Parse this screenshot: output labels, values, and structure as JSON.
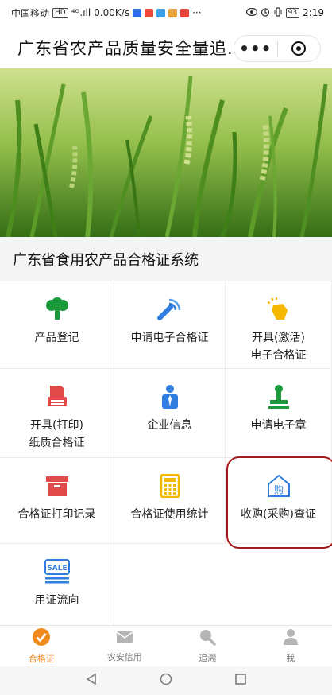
{
  "status_bar": {
    "carrier": "中国移动",
    "net_type": "HD",
    "signal": "⁴ᴳ.ıll",
    "speed": "0.00K/s",
    "extra": "···",
    "battery": "93",
    "time": "2:19"
  },
  "header": {
    "title": "广东省农产品质量安全量追...",
    "more_label": "•••"
  },
  "section": {
    "title": "广东省食用农产品合格证系统"
  },
  "grid": {
    "items": [
      {
        "label": "产品登记",
        "label2": "",
        "icon": "broccoli-icon",
        "color": "#1a9a3a"
      },
      {
        "label": "申请电子合格证",
        "label2": "",
        "icon": "satellite-dish-icon",
        "color": "#2f7de0"
      },
      {
        "label": "开具(激活)",
        "label2": "电子合格证",
        "icon": "pointer-hand-icon",
        "color": "#f5b800"
      },
      {
        "label": "开具(打印)",
        "label2": "纸质合格证",
        "icon": "printer-icon",
        "color": "#e04a4a"
      },
      {
        "label": "企业信息",
        "label2": "",
        "icon": "user-tie-icon",
        "color": "#2f7de0"
      },
      {
        "label": "申请电子章",
        "label2": "",
        "icon": "stamp-icon",
        "color": "#1a9a3a"
      },
      {
        "label": "合格证打印记录",
        "label2": "",
        "icon": "archive-box-icon",
        "color": "#e04a4a"
      },
      {
        "label": "合格证使用统计",
        "label2": "",
        "icon": "calculator-icon",
        "color": "#f5b800"
      },
      {
        "label": "收购(采购)查证",
        "label2": "",
        "icon": "purchase-house-icon",
        "color": "#2f7de0",
        "icon_text": "购"
      },
      {
        "label": "用证流向",
        "label2": "",
        "icon": "sale-tag-icon",
        "color": "#2f7de0",
        "icon_text": "SALE"
      }
    ]
  },
  "tabs": [
    {
      "label": "合格证",
      "icon": "check-circle-icon",
      "active": true
    },
    {
      "label": "农安信用",
      "icon": "envelope-icon",
      "active": false
    },
    {
      "label": "追溯",
      "icon": "magnifier-icon",
      "active": false
    },
    {
      "label": "我",
      "icon": "person-icon",
      "active": false
    }
  ],
  "colors": {
    "accent": "#f08a1c",
    "highlight": "#a31a1a"
  }
}
